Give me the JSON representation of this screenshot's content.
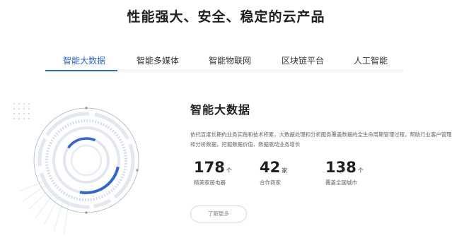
{
  "header": {
    "title": "性能强大、安全、稳定的云产品"
  },
  "tabs": [
    {
      "label": "智能大数据",
      "active": true
    },
    {
      "label": "智能多媒体",
      "active": false
    },
    {
      "label": "智能物联网",
      "active": false
    },
    {
      "label": "区块链平台",
      "active": false
    },
    {
      "label": "人工智能",
      "active": false
    }
  ],
  "content": {
    "title": "智能大数据",
    "description": "依托百度长期的业务实践和技术积累，大数据处理和分析服务覆盖数据的全生命周期管理过程，帮助行业客户管理和分析数据，挖掘数据价值，数据驱动业务增长",
    "stats": [
      {
        "value": "178",
        "unit": "个",
        "label": "精美家居电器"
      },
      {
        "value": "42",
        "unit": "家",
        "label": "合作商家"
      },
      {
        "value": "138",
        "unit": "个",
        "label": "覆盖全国城市"
      }
    ],
    "more_label": "了解更多"
  },
  "colors": {
    "accent": "#2d66d8",
    "ring_light": "#dfe4ee",
    "text_dark": "#1f1f1f",
    "text_muted": "#666666"
  },
  "icons": {
    "illustration": "big-data-rings-illustration"
  }
}
